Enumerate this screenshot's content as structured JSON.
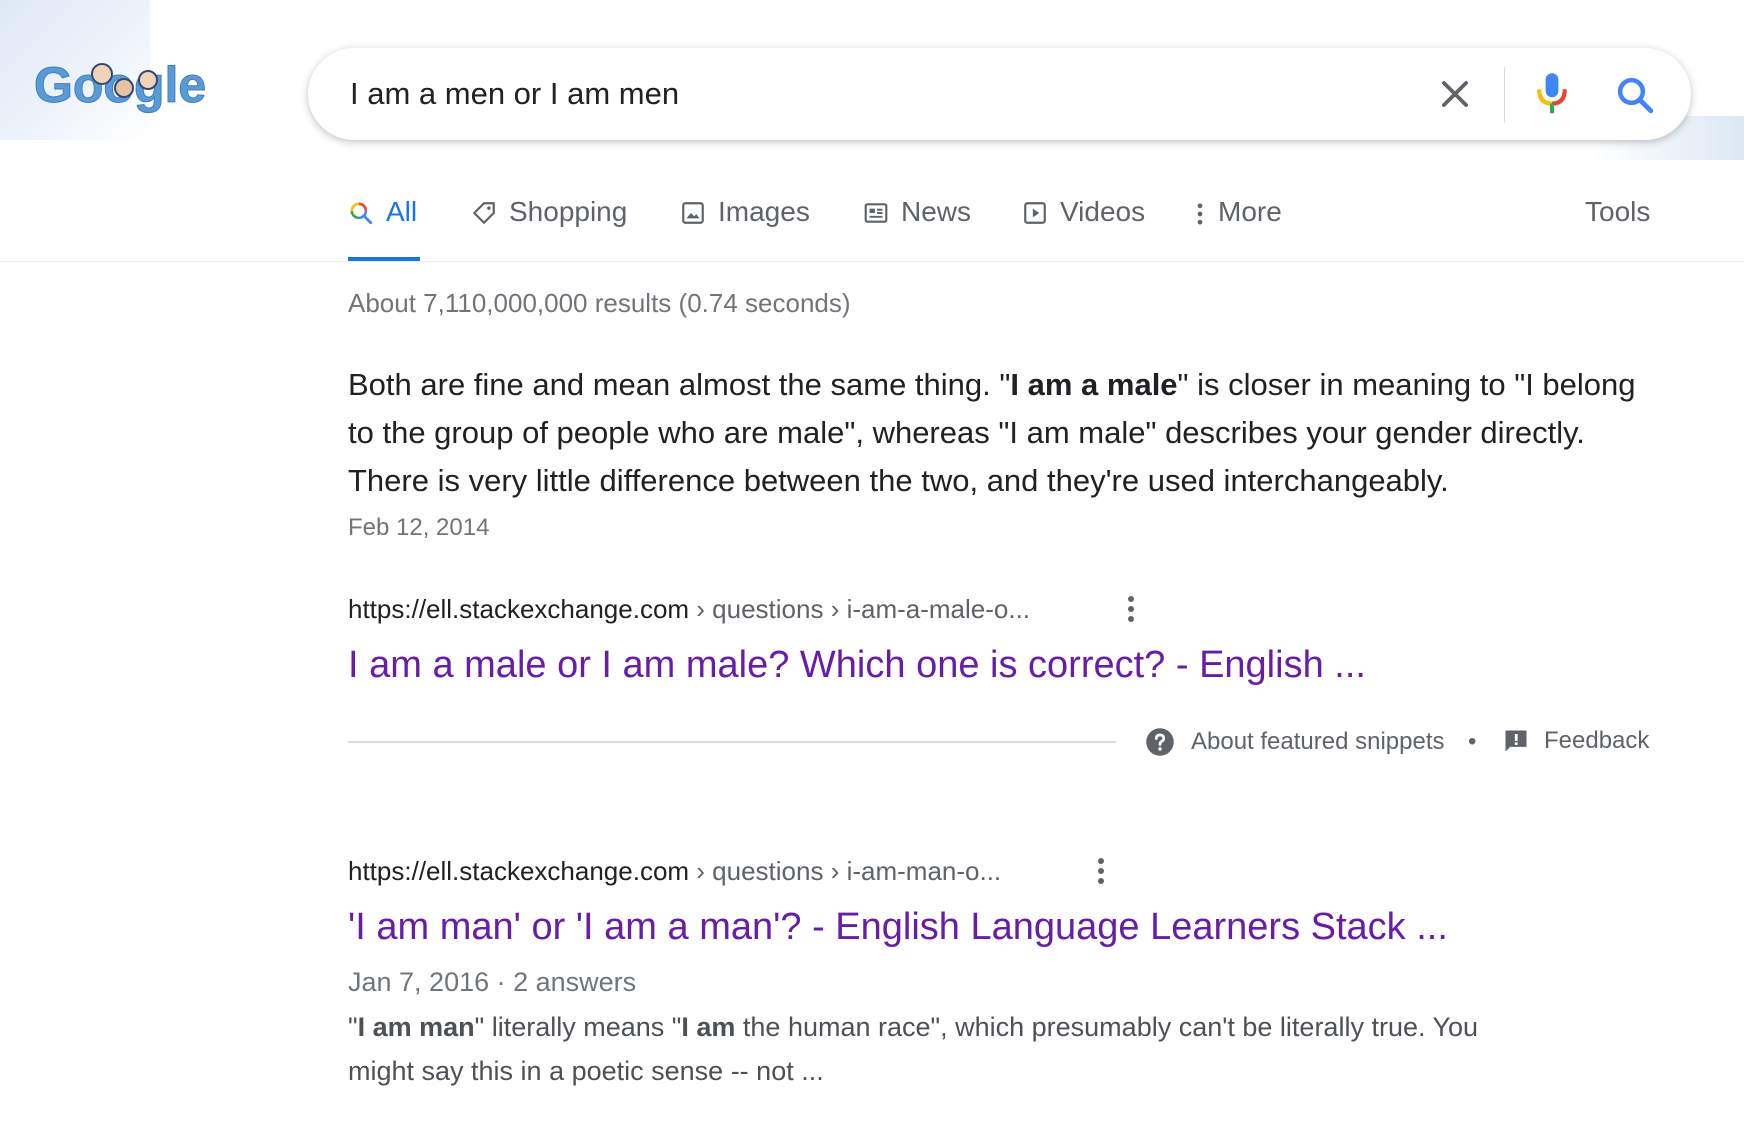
{
  "logo": {
    "text": "Google"
  },
  "search": {
    "query": "I am a men or I am men"
  },
  "tabs": [
    {
      "label": "All",
      "icon": "search-icon"
    },
    {
      "label": "Shopping",
      "icon": "tag-icon"
    },
    {
      "label": "Images",
      "icon": "image-icon"
    },
    {
      "label": "News",
      "icon": "news-icon"
    },
    {
      "label": "Videos",
      "icon": "play-icon"
    },
    {
      "label": "More",
      "icon": "more-vert-icon"
    }
  ],
  "tools_label": "Tools",
  "stats": "About 7,110,000,000 results (0.74 seconds)",
  "snippet": {
    "text_1": "Both are fine and mean almost the same thing. \"",
    "bold_1": "I am a male",
    "text_2": "\" is closer in meaning to \"I belong to the group of people who are male\", whereas \"I am male\" describes your gender directly. There is very little difference between the two, and they're used interchangeably.",
    "date": "Feb 12, 2014"
  },
  "result1": {
    "domain": "https://ell.stackexchange.com",
    "path": " › questions › i-am-a-male-o...",
    "title": "I am a male or I am male? Which one is correct? - English ..."
  },
  "featured": {
    "about": "About featured snippets",
    "separator": "•",
    "feedback": "Feedback"
  },
  "result2": {
    "domain": "https://ell.stackexchange.com",
    "path": " › questions › i-am-man-o...",
    "title": "'I am man' or 'I am a man'? - English Language Learners Stack ...",
    "meta": "Jan 7, 2016 · 2 answers",
    "desc": {
      "q1": "\"",
      "b1": "I am man",
      "t1": "\" literally means \"",
      "b2": "I am",
      "t2": " the human race\", which presumably can't be literally true. You might say this in a poetic sense -- not ..."
    }
  },
  "colors": {
    "link_visited": "#681da8",
    "accent": "#1a73e8",
    "secondary_text": "#70757a"
  }
}
